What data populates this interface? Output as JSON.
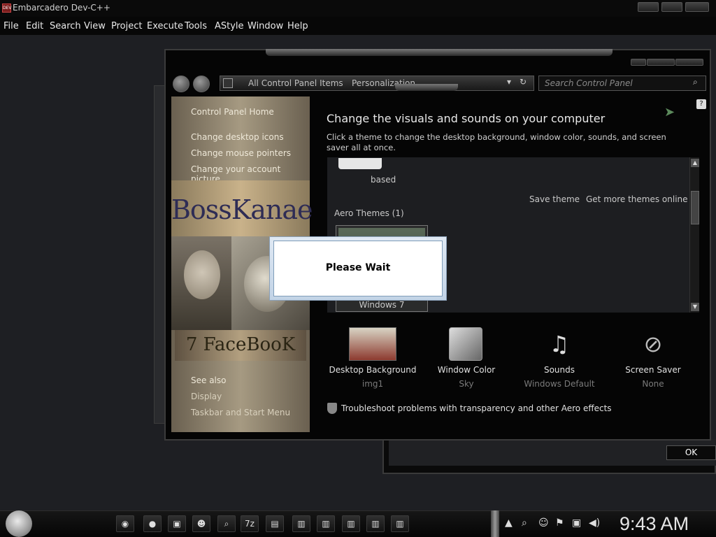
{
  "app": {
    "title": "Embarcadero Dev-C++",
    "icon_label": "DEV",
    "menu": [
      "File",
      "Edit",
      "Search",
      "View",
      "Project",
      "Execute",
      "Tools",
      "AStyle",
      "Window",
      "Help"
    ]
  },
  "control_panel": {
    "breadcrumb": [
      "All Control Panel Items",
      "Personalization"
    ],
    "search_placeholder": "Search Control Panel",
    "sidebar": {
      "home": "Control Panel Home",
      "links": [
        "Change desktop icons",
        "Change mouse pointers",
        "Change your account picture"
      ],
      "banner_top": "BossKanae",
      "banner_bottom": "7 FaceBooK",
      "see_also_title": "See also",
      "see_also": [
        "Display",
        "Taskbar and Start Menu"
      ]
    },
    "heading": "Change the visuals and sounds on your computer",
    "subheading": "Click a theme to change the desktop background, window color, sounds, and screen saver all at once.",
    "theme_list": {
      "partial_label": "based",
      "save_theme": "Save theme",
      "get_more": "Get more themes online",
      "group_title": "Aero Themes (1)",
      "theme_name": "Windows 7"
    },
    "bottom_items": [
      {
        "label": "Desktop Background",
        "value": "img1",
        "icon": "desktop-background-icon"
      },
      {
        "label": "Window Color",
        "value": "Sky",
        "icon": "window-color-icon"
      },
      {
        "label": "Sounds",
        "value": "Windows Default",
        "icon": "sounds-icon"
      },
      {
        "label": "Screen Saver",
        "value": "None",
        "icon": "screen-saver-icon"
      }
    ],
    "troubleshoot": "Troubleshoot problems with transparency and other Aero effects"
  },
  "dialog": {
    "message": "Please Wait"
  },
  "underlay": {
    "ok": "OK"
  },
  "taskbar": {
    "pinned_labels": [
      "",
      "",
      "",
      "",
      "",
      "7z",
      "",
      "",
      "",
      "",
      "",
      ""
    ],
    "clock": "9:43 AM"
  }
}
